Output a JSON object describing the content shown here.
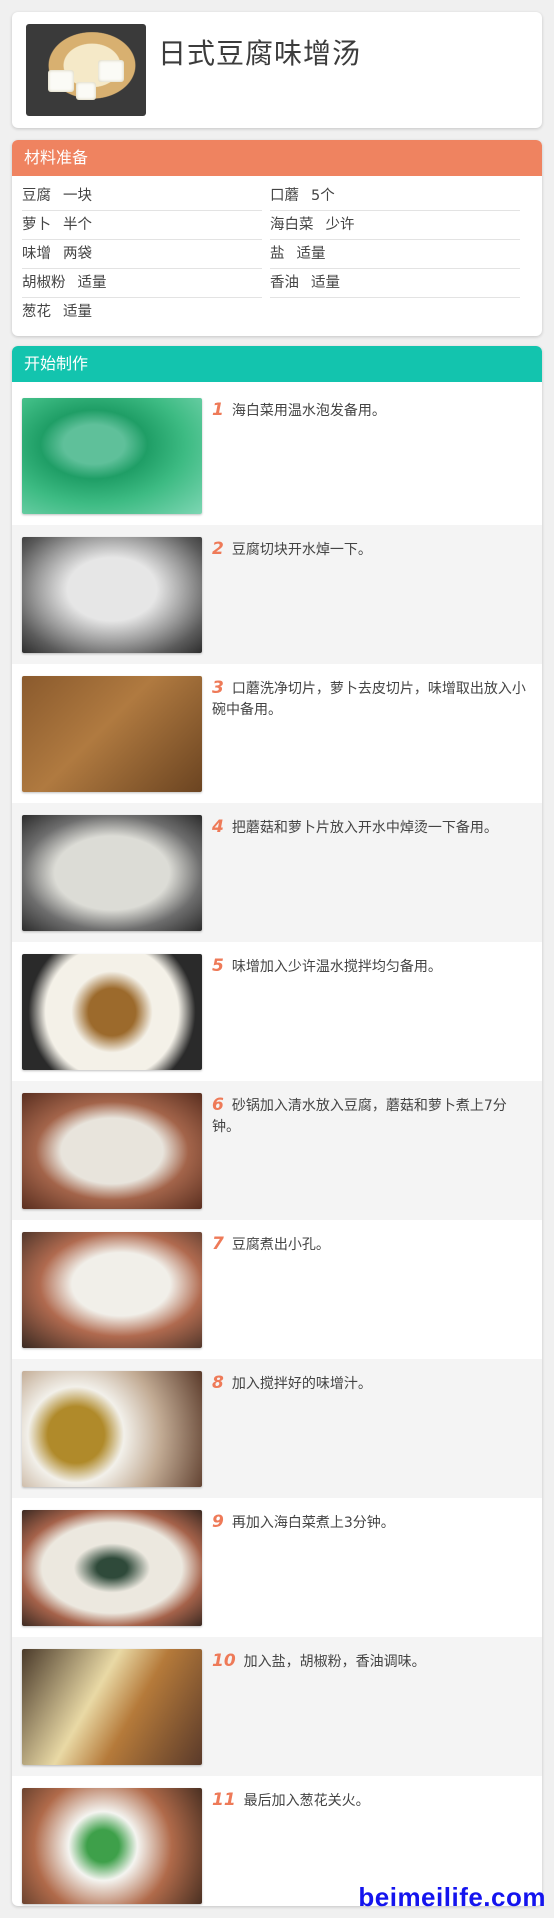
{
  "header": {
    "title": "日式豆腐味增汤",
    "image_icon": "miso-soup-photo"
  },
  "ingredients": {
    "title": "材料准备",
    "accent": "#ef8360",
    "items": [
      {
        "name": "豆腐",
        "qty": "一块"
      },
      {
        "name": "口蘑",
        "qty": "5个"
      },
      {
        "name": "萝卜",
        "qty": "半个"
      },
      {
        "name": "海白菜",
        "qty": "少许"
      },
      {
        "name": "味增",
        "qty": "两袋"
      },
      {
        "name": "盐",
        "qty": "适量"
      },
      {
        "name": "胡椒粉",
        "qty": "适量"
      },
      {
        "name": "香油",
        "qty": "适量"
      },
      {
        "name": "葱花",
        "qty": "适量"
      }
    ]
  },
  "steps": {
    "title": "开始制作",
    "accent": "#13c4ae",
    "items": [
      {
        "num": "1",
        "text": "海白菜用温水泡发备用。",
        "photo": "seaweed-soaking-photo"
      },
      {
        "num": "2",
        "text": "豆腐切块开水焯一下。",
        "photo": "tofu-blanching-photo"
      },
      {
        "num": "3",
        "text": "口蘑洗净切片，萝卜去皮切片，味增取出放入小碗中备用。",
        "photo": "sliced-vegetables-photo"
      },
      {
        "num": "4",
        "text": "把蘑菇和萝卜片放入开水中焯烫一下备用。",
        "photo": "blanching-mushrooms-photo"
      },
      {
        "num": "5",
        "text": "味增加入少许温水搅拌均匀备用。",
        "photo": "miso-bowl-photo"
      },
      {
        "num": "6",
        "text": "砂锅加入清水放入豆腐，蘑菇和萝卜煮上7分钟。",
        "photo": "clay-pot-photo"
      },
      {
        "num": "7",
        "text": "豆腐煮出小孔。",
        "photo": "boiling-tofu-photo"
      },
      {
        "num": "8",
        "text": "加入搅拌好的味增汁。",
        "photo": "adding-miso-photo"
      },
      {
        "num": "9",
        "text": "再加入海白菜煮上3分钟。",
        "photo": "adding-seaweed-photo"
      },
      {
        "num": "10",
        "text": "加入盐，胡椒粉，香油调味。",
        "photo": "seasoning-photo"
      },
      {
        "num": "11",
        "text": "最后加入葱花关火。",
        "photo": "scallions-photo"
      }
    ]
  },
  "watermark": "beimeilife.com"
}
